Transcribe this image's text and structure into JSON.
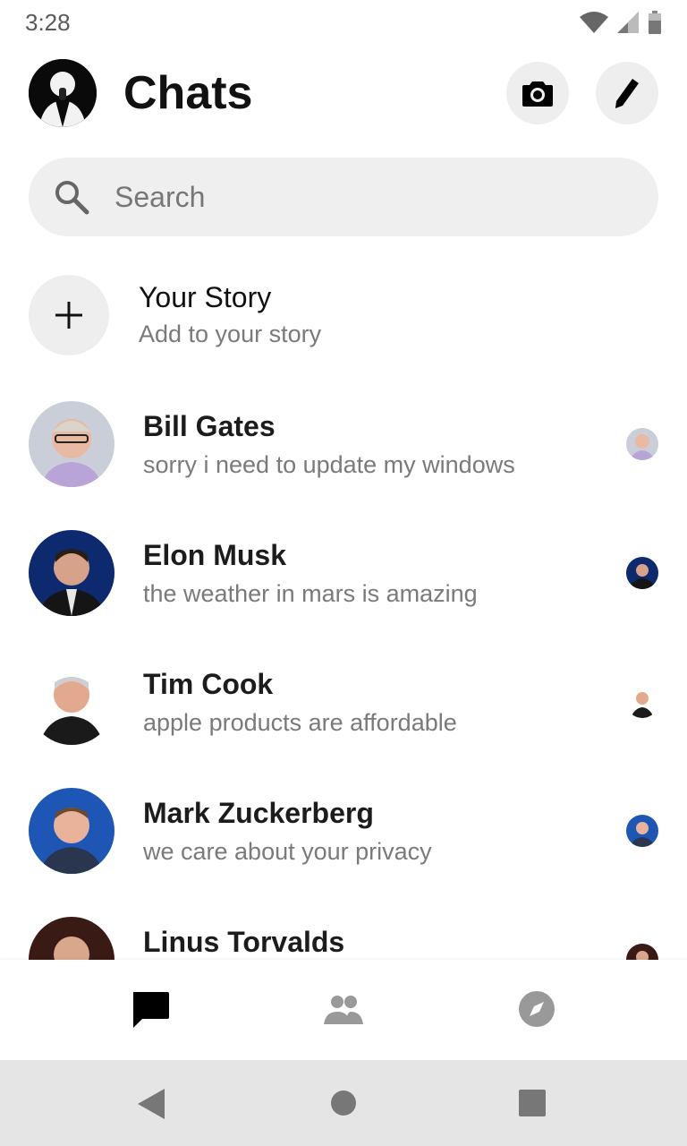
{
  "status_bar": {
    "time": "3:28"
  },
  "header": {
    "title": "Chats"
  },
  "search": {
    "placeholder": "Search"
  },
  "story": {
    "title": "Your Story",
    "subtitle": "Add to your story"
  },
  "chats": [
    {
      "name": "Bill Gates",
      "message": "sorry i need to update my windows"
    },
    {
      "name": "Elon Musk",
      "message": "the weather in mars is amazing"
    },
    {
      "name": "Tim Cook",
      "message": "apple products are affordable"
    },
    {
      "name": "Mark Zuckerberg",
      "message": "we care about your privacy"
    },
    {
      "name": "Linus Torvalds",
      "message": ""
    }
  ],
  "bottom_nav": {
    "items": [
      {
        "icon": "chat-icon",
        "active": true
      },
      {
        "icon": "people-icon",
        "active": false
      },
      {
        "icon": "compass-icon",
        "active": false
      }
    ]
  },
  "system_nav": {
    "items": [
      "back-icon",
      "home-icon",
      "recents-icon"
    ]
  },
  "colors": {
    "text": "#1c1c1c",
    "muted": "#7a7a7a",
    "surface": "#efefef",
    "active_icon": "#000000",
    "inactive_icon": "#999999"
  }
}
